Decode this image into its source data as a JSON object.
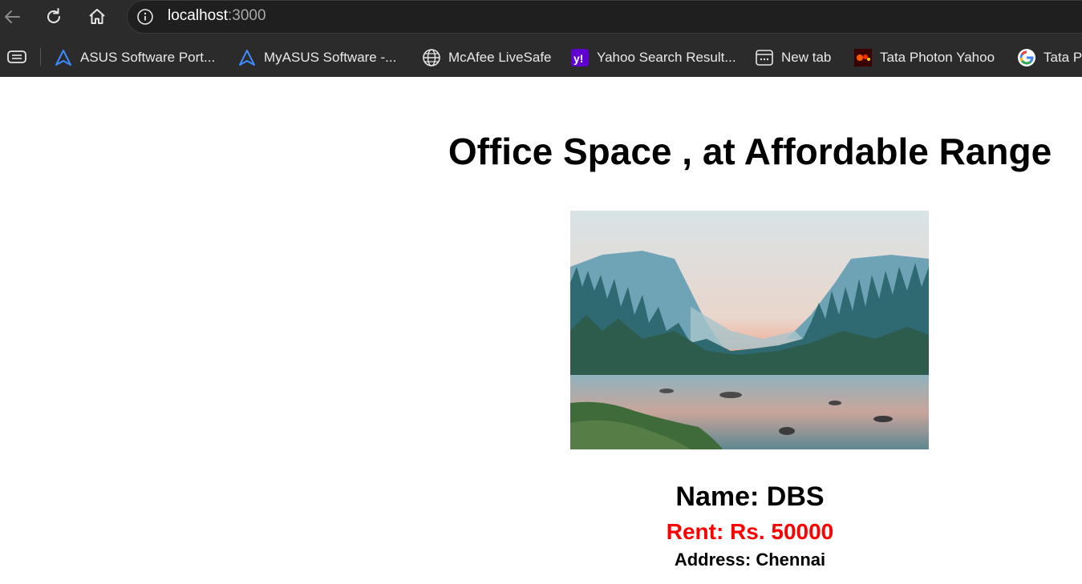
{
  "browser": {
    "address_host": "localhost",
    "address_port": ":3000",
    "bookmarks": [
      {
        "label": "ASUS Software Port...",
        "icon": "asus-icon"
      },
      {
        "label": "MyASUS Software -...",
        "icon": "asus-icon"
      },
      {
        "label": "McAfee LiveSafe",
        "icon": "globe-icon"
      },
      {
        "label": "Yahoo Search Result...",
        "icon": "yahoo-icon"
      },
      {
        "label": "New tab",
        "icon": "new-tab-icon"
      },
      {
        "label": "Tata Photon Yahoo",
        "icon": "tata-photon-icon"
      },
      {
        "label": "Tata P",
        "icon": "google-icon"
      }
    ]
  },
  "page": {
    "heading": "Office Space , at Affordable Range",
    "image_icon": "landscape-photo",
    "office": {
      "name": "Name: DBS",
      "rent": "Rent: Rs. 50000",
      "address": "Address: Chennai"
    }
  },
  "colors": {
    "chrome_bg": "#2b2b2b",
    "rent_color": "#ff0000",
    "heading_color": "#000000"
  }
}
